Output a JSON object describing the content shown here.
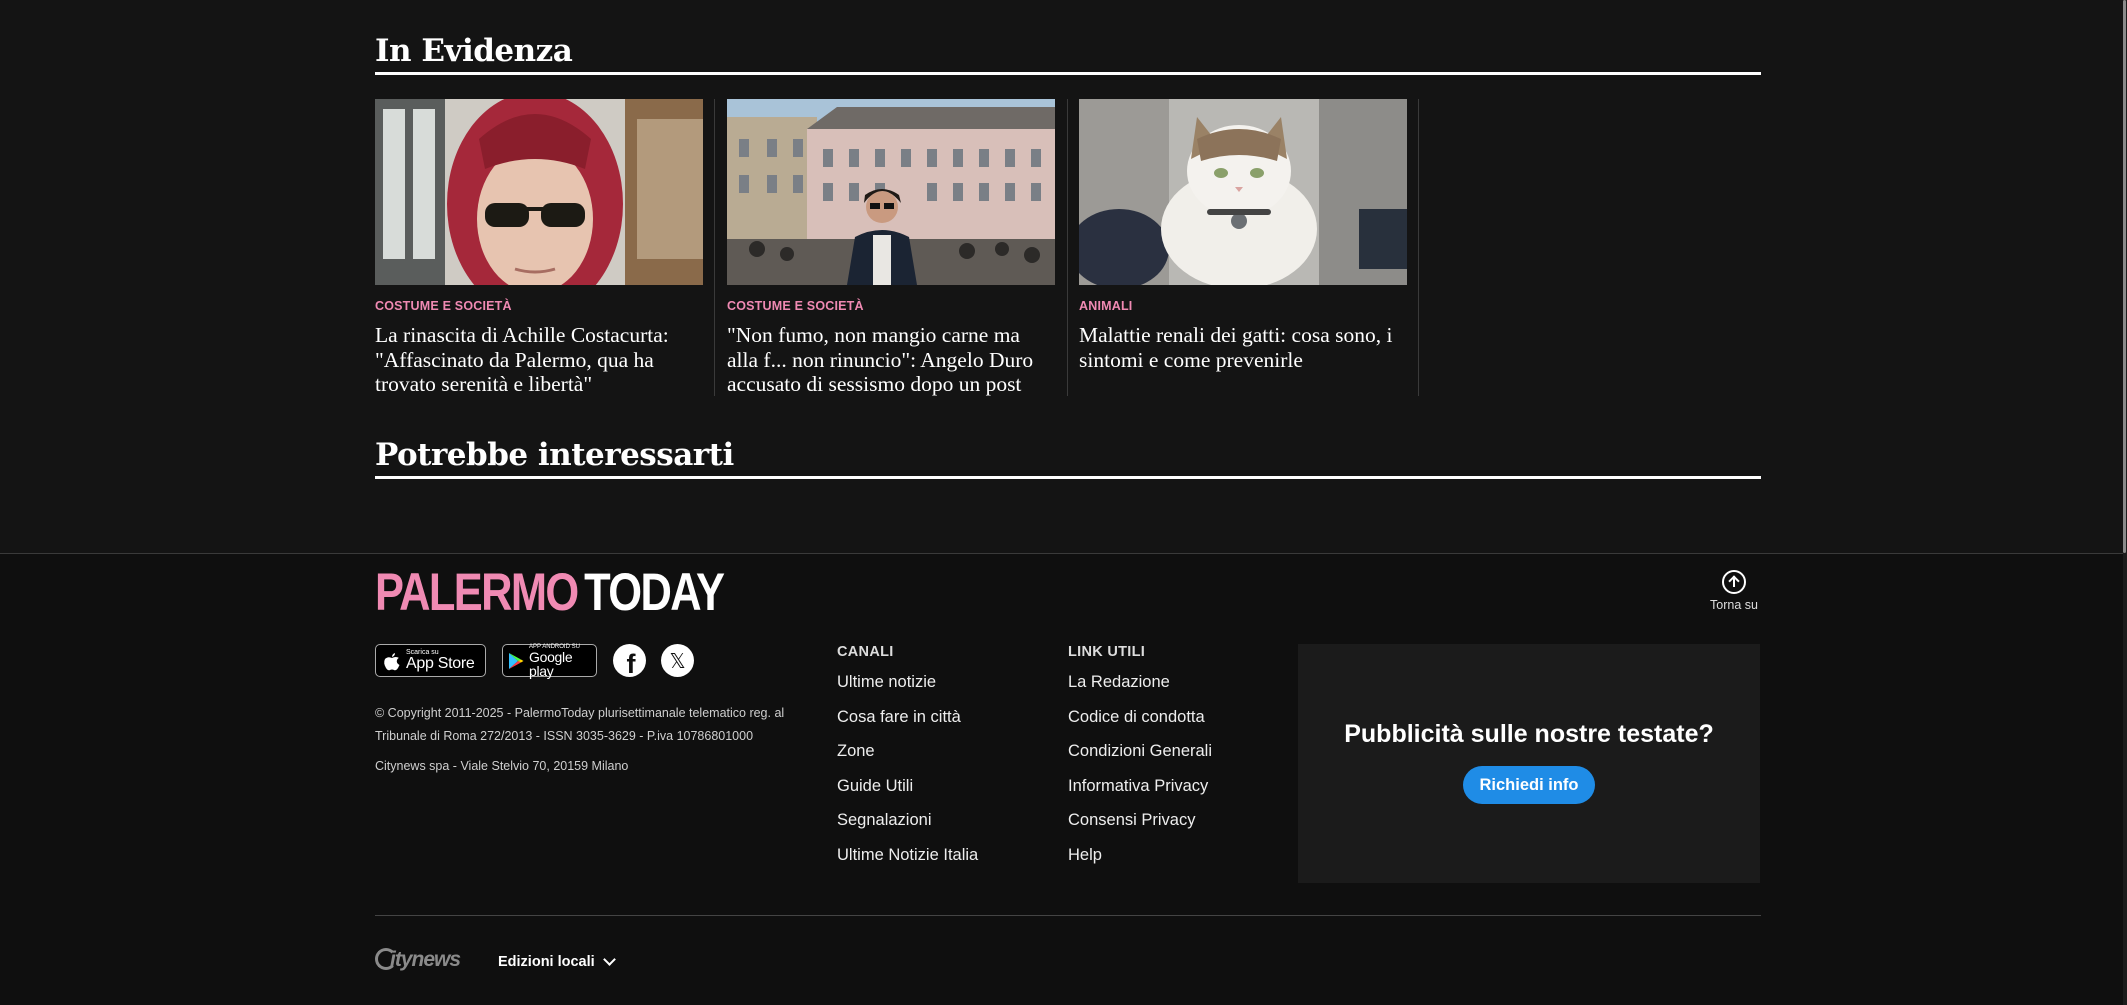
{
  "sections": {
    "evidenza_title": "In Evidenza",
    "potrebbe_title": "Potrebbe interessarti"
  },
  "cards": [
    {
      "category": "COSTUME E SOCIETÀ",
      "headline": "La rinascita di Achille Costacurta: \"Affascinato da Palermo, qua ha trovato serenità e libertà\""
    },
    {
      "category": "COSTUME E SOCIETÀ",
      "headline": "\"Non fumo, non mangio carne ma alla f... non rinuncio\": Angelo Duro accusato di sessismo dopo un post"
    },
    {
      "category": "ANIMALI",
      "headline": "Malattie renali dei gatti: cosa sono, i sintomi e come prevenirle"
    }
  ],
  "footer": {
    "logo_left": "PALERMO",
    "logo_right": "TODAY",
    "back_to_top": "Torna su",
    "app_store": {
      "small": "Scarica su",
      "big": "App Store"
    },
    "google_play": {
      "small": "APP ANDROID SU",
      "big": "Google play"
    },
    "copyright": "© Copyright 2011-2025 - PalermoToday plurisettimanale telematico reg. al Tribunale di Roma 272/2013 - ISSN 3035-3629 - P.iva 10786801000",
    "address": "Citynews spa - Viale Stelvio 70, 20159 Milano",
    "canali": {
      "heading": "CANALI",
      "items": [
        "Ultime notizie",
        "Cosa fare in città",
        "Zone",
        "Guide Utili",
        "Segnalazioni",
        "Ultime Notizie Italia"
      ]
    },
    "link_utili": {
      "heading": "LINK UTILI",
      "items": [
        "La Redazione",
        "Codice di condotta",
        "Condizioni Generali",
        "Informativa Privacy",
        "Consensi Privacy",
        "Help"
      ]
    },
    "promo": {
      "title": "Pubblicità sulle nostre testate?",
      "button": "Richiedi info"
    },
    "citynews_logo": "citynews",
    "editions": "Edizioni locali"
  },
  "colors": {
    "brand_pink": "#f08ab3",
    "button_blue": "#1f8ce6",
    "background": "#141414"
  }
}
